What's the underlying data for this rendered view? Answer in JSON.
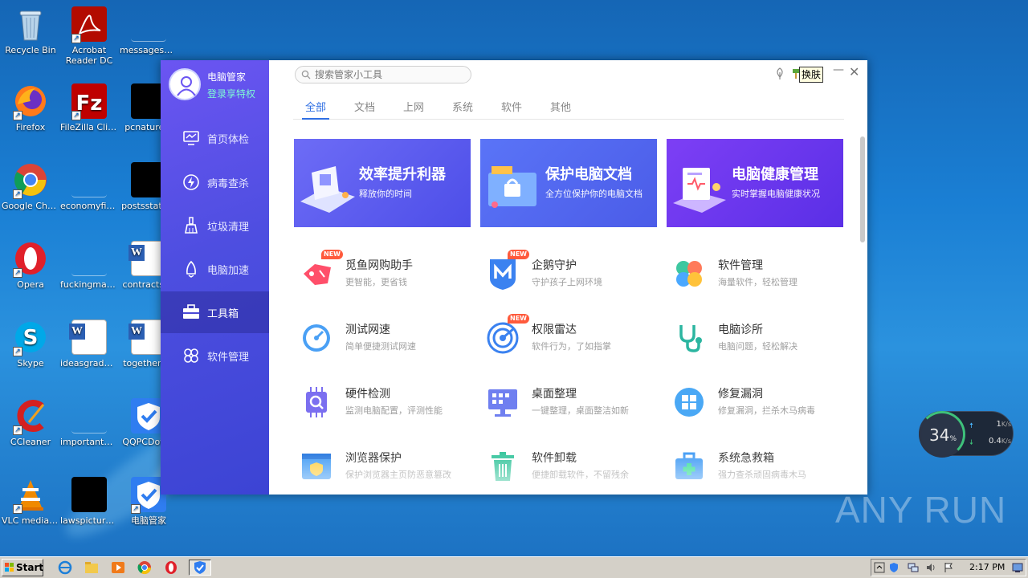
{
  "desktop": {
    "icons": [
      {
        "label": "Recycle Bin"
      },
      {
        "label": "Acrobat Reader DC"
      },
      {
        "label": "messagesd..."
      },
      {
        "label": "Firefox"
      },
      {
        "label": "FileZilla Client"
      },
      {
        "label": "pcnature..."
      },
      {
        "label": "Google Chrome"
      },
      {
        "label": "economyfiv..."
      },
      {
        "label": "postsstate..."
      },
      {
        "label": "Opera"
      },
      {
        "label": "fuckingmag..."
      },
      {
        "label": "contractsi..."
      },
      {
        "label": "Skype"
      },
      {
        "label": "ideasgrade.rtf"
      },
      {
        "label": "togetherc..."
      },
      {
        "label": "CCleaner"
      },
      {
        "label": "importantm..."
      },
      {
        "label": "QQPCDow..."
      },
      {
        "label": "VLC media player"
      },
      {
        "label": "lawspicture..."
      },
      {
        "label": "电脑管家"
      }
    ]
  },
  "app": {
    "name": "电脑管家",
    "vip_link": "登录享特权",
    "nav": [
      {
        "label": "首页体检",
        "icon": "monitor-icon"
      },
      {
        "label": "病毒查杀",
        "icon": "lightning-icon"
      },
      {
        "label": "垃圾清理",
        "icon": "broom-icon"
      },
      {
        "label": "电脑加速",
        "icon": "rocket-icon"
      },
      {
        "label": "工具箱",
        "icon": "toolbox-icon"
      },
      {
        "label": "软件管理",
        "icon": "apps-icon"
      }
    ],
    "active_nav": "工具箱",
    "search": {
      "placeholder": "搜索管家小工具"
    },
    "skin_label": "换肤",
    "tabs": [
      "全部",
      "文档",
      "上网",
      "系统",
      "软件",
      "其他"
    ],
    "active_tab": "全部",
    "banners": [
      {
        "title": "效率提升利器",
        "subtitle": "释放你的时间",
        "color": "#5a5cf0"
      },
      {
        "title": "保护电脑文档",
        "subtitle": "全方位保护你的电脑文档",
        "color": "#4e63ef"
      },
      {
        "title": "电脑健康管理",
        "subtitle": "实时掌握电脑健康状况",
        "color": "#6a3ff0"
      }
    ],
    "new_badge": "NEW",
    "tools": [
      {
        "name": "觅鱼网购助手",
        "desc": "更智能，更省钱",
        "new": true,
        "icon": "tag-icon"
      },
      {
        "name": "企鹅守护",
        "desc": "守护孩子上网环境",
        "new": true,
        "icon": "shield-m-icon"
      },
      {
        "name": "软件管理",
        "desc": "海量软件，轻松管理",
        "new": false,
        "icon": "clover-icon"
      },
      {
        "name": "测试网速",
        "desc": "简单便捷测试网速",
        "new": false,
        "icon": "speedometer-icon"
      },
      {
        "name": "权限雷达",
        "desc": "软件行为，了如指掌",
        "new": true,
        "icon": "radar-icon"
      },
      {
        "name": "电脑诊所",
        "desc": "电脑问题，轻松解决",
        "new": false,
        "icon": "stethoscope-icon"
      },
      {
        "name": "硬件检测",
        "desc": "监测电脑配置，评测性能",
        "new": false,
        "icon": "chip-icon"
      },
      {
        "name": "桌面整理",
        "desc": "一键整理，桌面整洁如新",
        "new": false,
        "icon": "desktop-icon"
      },
      {
        "name": "修复漏洞",
        "desc": "修复漏洞，拦杀木马病毒",
        "new": false,
        "icon": "windows-icon"
      },
      {
        "name": "浏览器保护",
        "desc": "保护浏览器主页防恶意篡改",
        "new": false,
        "icon": "browser-shield-icon"
      },
      {
        "name": "软件卸载",
        "desc": "便捷卸载软件，不留残余",
        "new": false,
        "icon": "trash-icon"
      },
      {
        "name": "系统急救箱",
        "desc": "强力查杀顽固病毒木马",
        "new": false,
        "icon": "firstaid-icon"
      }
    ]
  },
  "net_widget": {
    "percent": "34",
    "percent_unit": "%",
    "up": "1",
    "down": "0.4",
    "unit": "K/s"
  },
  "watermark": "ANY RUN",
  "taskbar": {
    "start_label": "Start",
    "clock": "2:17 PM"
  }
}
